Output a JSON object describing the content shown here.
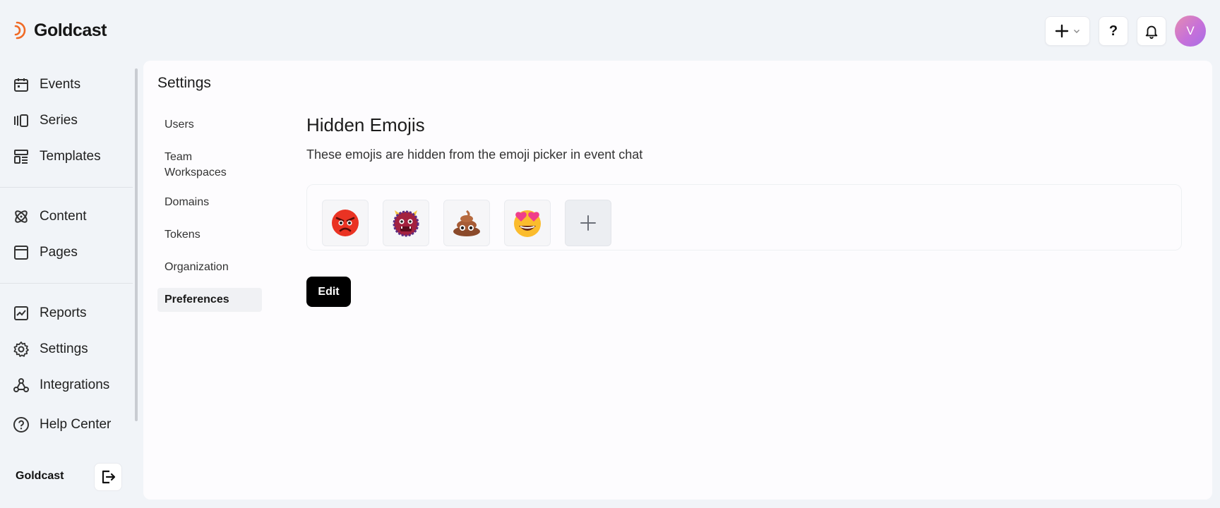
{
  "app": {
    "name": "Goldcast",
    "brand_color": "#f06a25"
  },
  "topbar": {
    "add_icon": "plus-icon",
    "help_label": "?",
    "notification_icon": "bell-icon",
    "avatar_initial": "V"
  },
  "sidebar": {
    "groups": [
      [
        {
          "label": "Events",
          "icon": "calendar-icon"
        },
        {
          "label": "Series",
          "icon": "series-icon"
        },
        {
          "label": "Templates",
          "icon": "templates-icon"
        }
      ],
      [
        {
          "label": "Content",
          "icon": "atom-icon"
        },
        {
          "label": "Pages",
          "icon": "page-icon"
        }
      ],
      [
        {
          "label": "Reports",
          "icon": "chart-icon"
        },
        {
          "label": "Settings",
          "icon": "gear-icon"
        },
        {
          "label": "Integrations",
          "icon": "webhook-icon"
        },
        {
          "label": "Help Center",
          "icon": "help-circle-icon"
        }
      ]
    ],
    "org_name": "Goldcast",
    "logout_icon": "logout-icon"
  },
  "settings": {
    "title": "Settings",
    "nav": [
      {
        "label": "Users",
        "active": false
      },
      {
        "label": "Team Workspaces",
        "active": false
      },
      {
        "label": "Domains",
        "active": false
      },
      {
        "label": "Tokens",
        "active": false
      },
      {
        "label": "Organization",
        "active": false
      },
      {
        "label": "Preferences",
        "active": true
      }
    ],
    "section": {
      "title": "Hidden Emojis",
      "description": "These emojis are hidden from the emoji picker in event chat",
      "emojis": [
        {
          "name": "angry-face-emoji"
        },
        {
          "name": "ogre-emoji"
        },
        {
          "name": "pile-of-poo-emoji"
        },
        {
          "name": "heart-eyes-emoji"
        }
      ],
      "add_icon": "plus-icon",
      "edit_label": "Edit"
    }
  }
}
